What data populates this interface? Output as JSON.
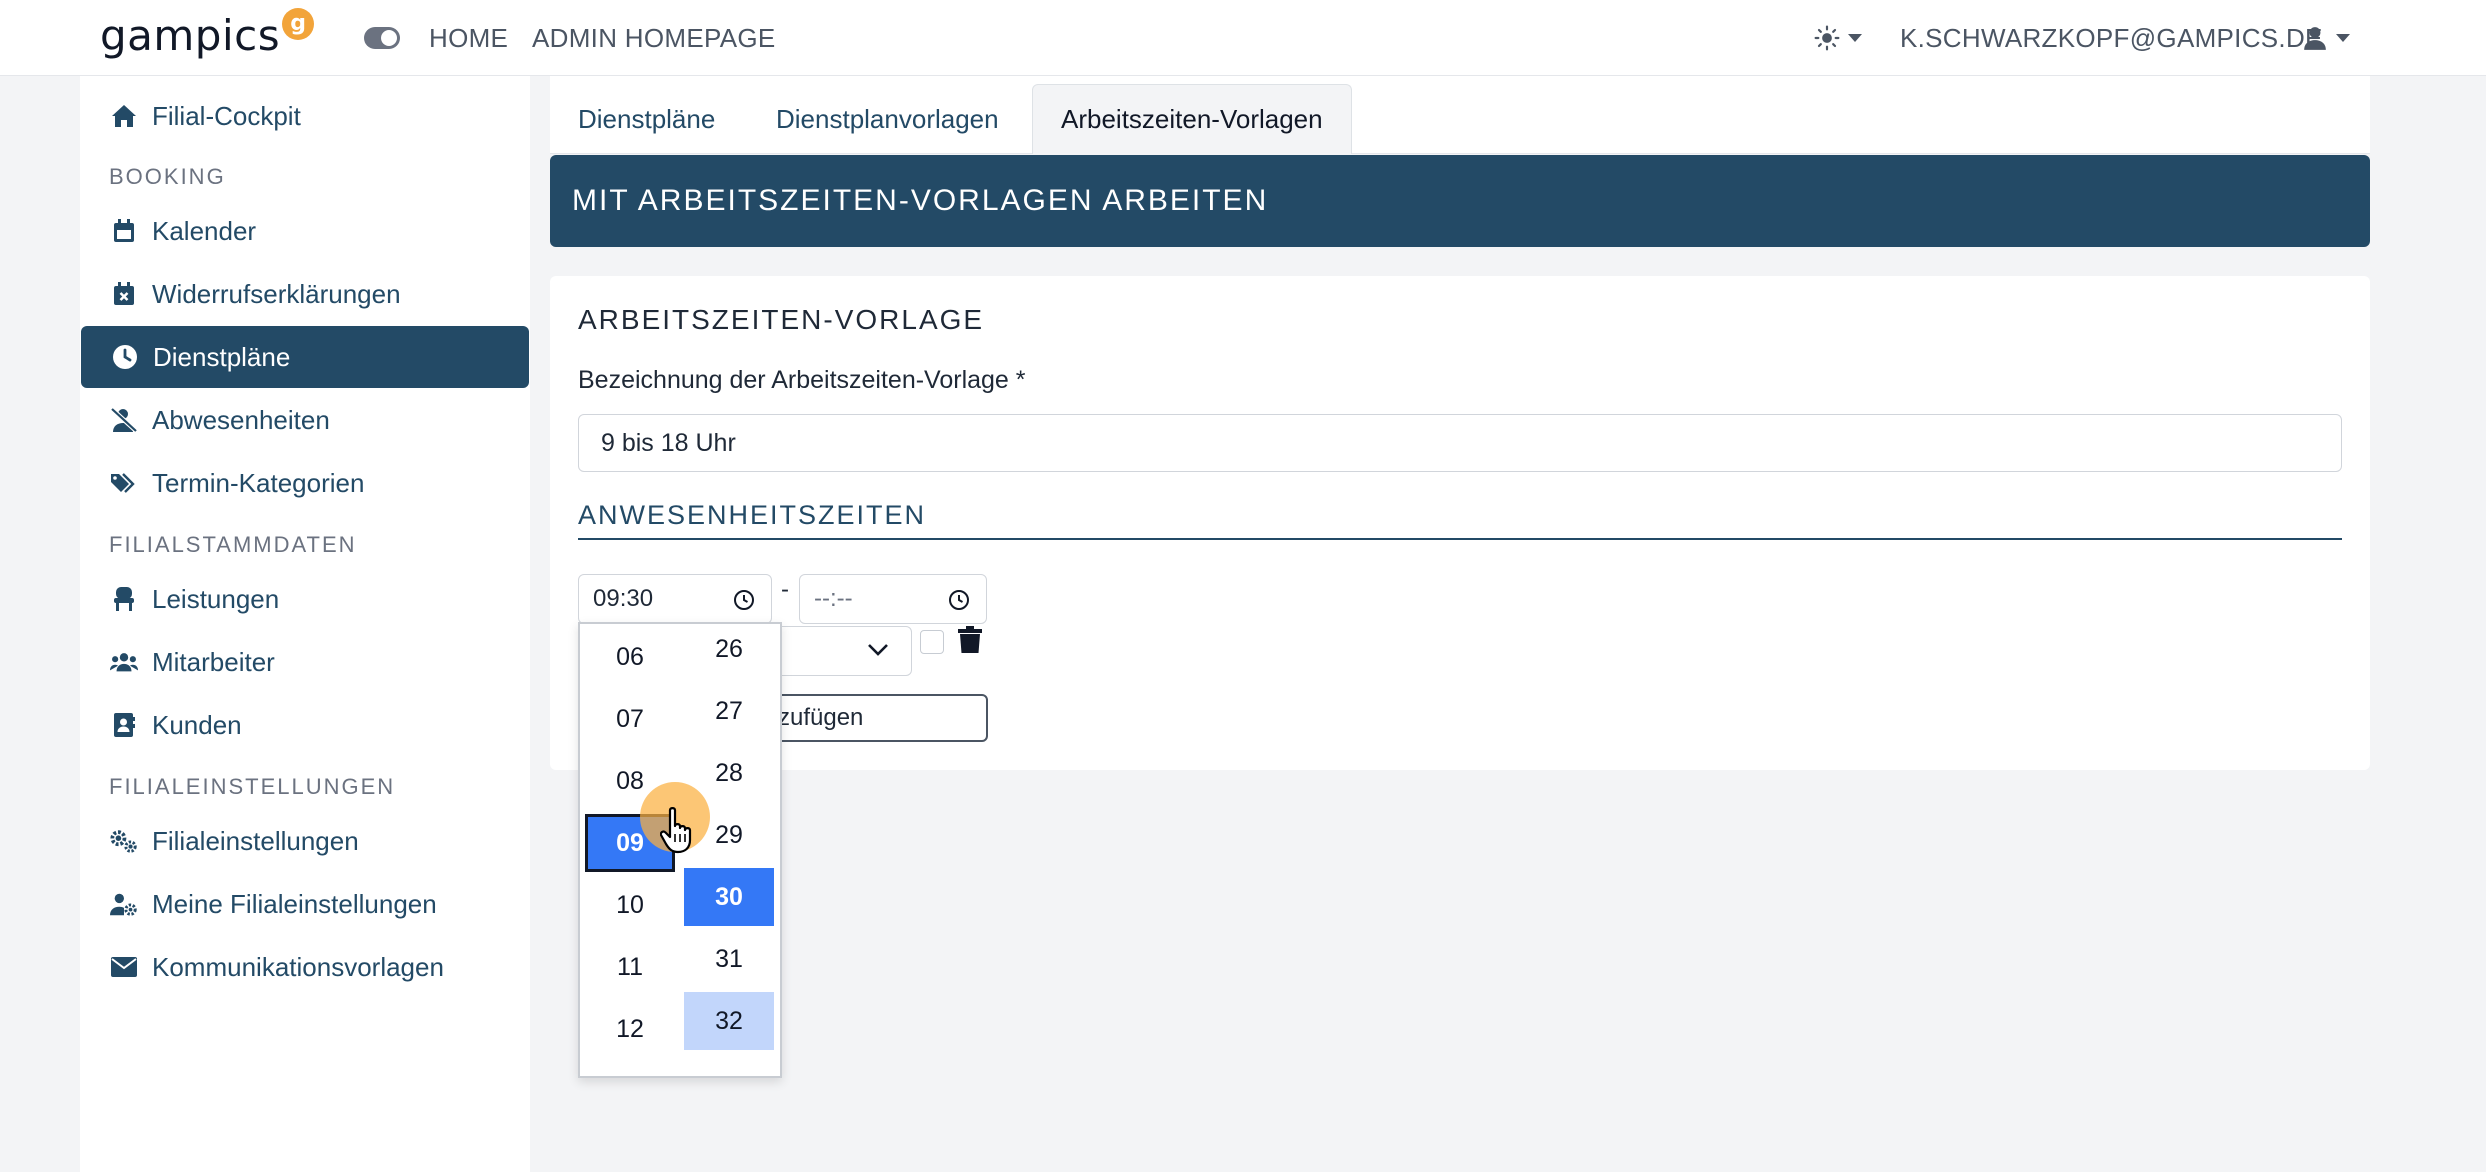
{
  "brand": {
    "name": "gampics",
    "badge": "g",
    "accent": "#f2a43a"
  },
  "topnav": {
    "home": "HOME",
    "admin_homepage": "ADMIN HOMEPAGE",
    "user_email": "K.SCHWARZKOPF@GAMPICS.DE"
  },
  "sidebar": {
    "cockpit": "Filial-Cockpit",
    "heading_booking": "BOOKING",
    "kalender": "Kalender",
    "widerruf": "Widerrufserklärungen",
    "dienstplaene": "Dienstpläne",
    "abwesenheiten": "Abwesenheiten",
    "termin_kategorien": "Termin-Kategorien",
    "heading_stammdaten": "FILIALSTAMMDATEN",
    "leistungen": "Leistungen",
    "mitarbeiter": "Mitarbeiter",
    "kunden": "Kunden",
    "heading_einstellungen": "FILIALEINSTELLUNGEN",
    "filialeinstellungen": "Filialeinstellungen",
    "meine_filialeinstellungen": "Meine Filialeinstellungen",
    "kommunikationsvorlagen": "Kommunikationsvorlagen"
  },
  "tabs": {
    "dienstplaene": "Dienstpläne",
    "dienstplanvorlagen": "Dienstplanvorlagen",
    "arbeitszeiten_vorlagen": "Arbeitszeiten-Vorlagen"
  },
  "banner": {
    "title": "MIT ARBEITSZEITEN-VORLAGEN ARBEITEN"
  },
  "form": {
    "card_title": "ARBEITSZEITEN-VORLAGE",
    "name_label": "Bezeichnung der Arbeitszeiten-Vorlage *",
    "name_value": "9 bis 18 Uhr",
    "section_title": "ANWESENHEITSZEITEN",
    "time_from": "09:30",
    "time_separator": "-",
    "time_to_placeholder": "--:--",
    "add_button_visible_text": "zufügen"
  },
  "time_picker": {
    "hours": [
      "06",
      "07",
      "08",
      "09",
      "10",
      "11",
      "12"
    ],
    "minutes": [
      "26",
      "27",
      "28",
      "29",
      "30",
      "31",
      "32"
    ],
    "selected_hour": "09",
    "selected_minute": "30",
    "hovered_minute": "32"
  },
  "colors": {
    "primary": "#234a66",
    "picker_selected": "#3478f6",
    "picker_hover": "#c2d6fb",
    "background": "#f3f4f6"
  }
}
